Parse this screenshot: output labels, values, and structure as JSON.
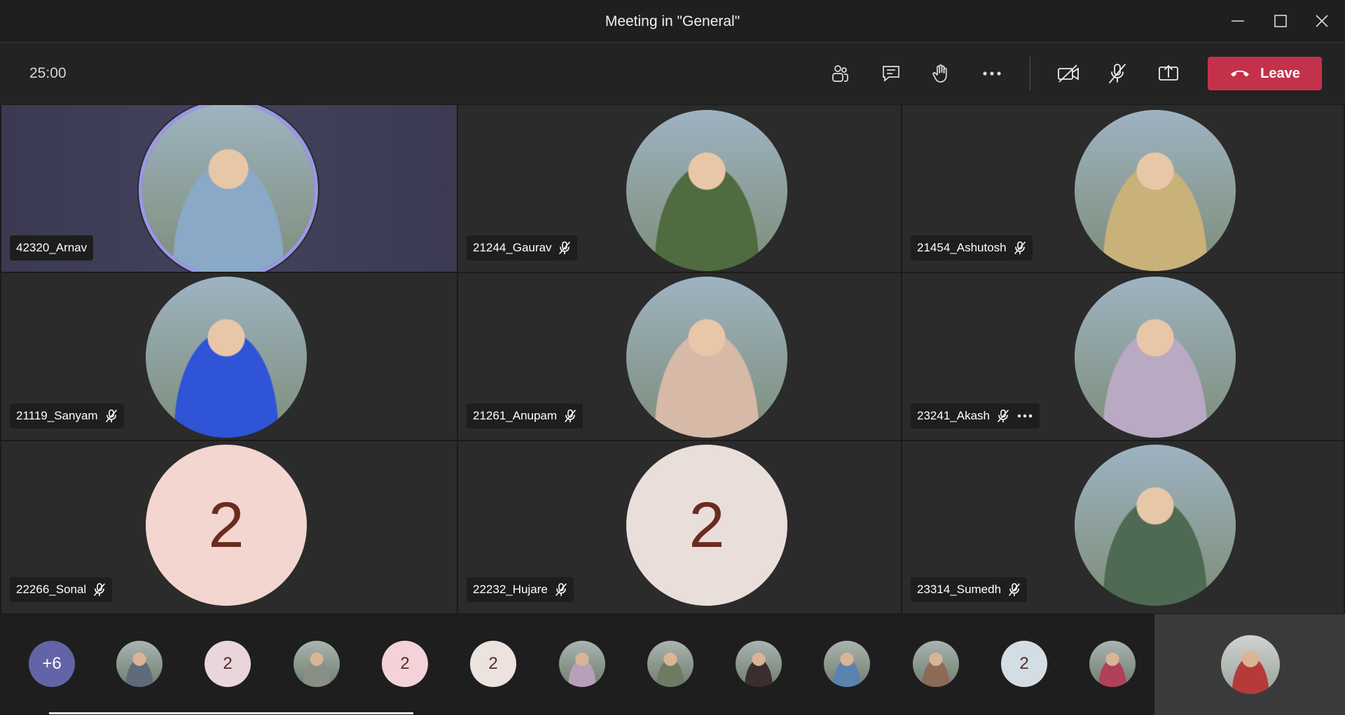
{
  "window": {
    "title": "Meeting in \"General\""
  },
  "toolbar": {
    "timer": "25:00",
    "leave_label": "Leave",
    "icons": [
      "participants-icon",
      "chat-icon",
      "raise-hand-icon",
      "more-icon",
      "camera-off-icon",
      "mic-off-icon",
      "share-screen-icon"
    ]
  },
  "participants": [
    {
      "name": "42320_Arnav",
      "muted": false,
      "speaking": true,
      "bg": "#8aa9c7"
    },
    {
      "name": "21244_Gaurav",
      "muted": true,
      "bg": "#4f6b3f"
    },
    {
      "name": "21454_Ashutosh",
      "muted": true,
      "bg": "#c9b27a"
    },
    {
      "name": "21119_Sanyam",
      "muted": true,
      "bg": "#2f54d8"
    },
    {
      "name": "21261_Anupam",
      "muted": true,
      "bg": "#d7b9a8"
    },
    {
      "name": "23241_Akash",
      "muted": true,
      "more": true,
      "bg": "#b9a9c3"
    },
    {
      "name": "22266_Sonal",
      "muted": true,
      "initial": "2",
      "bg": "#f3d6cf"
    },
    {
      "name": "22232_Hujare",
      "muted": true,
      "initial": "2",
      "bg": "#eadeda"
    },
    {
      "name": "23314_Sumedh",
      "muted": true,
      "bg": "#4f6a52"
    }
  ],
  "strip": {
    "overflow": "+6",
    "items": [
      {
        "type": "photo",
        "bg": "#5d6b7a"
      },
      {
        "type": "initial",
        "text": "2",
        "bg": "#e8d6dc"
      },
      {
        "type": "photo",
        "bg": "#8a8f86"
      },
      {
        "type": "initial",
        "text": "2",
        "bg": "#f3d2d8"
      },
      {
        "type": "initial",
        "text": "2",
        "bg": "#ece2de"
      },
      {
        "type": "photo",
        "bg": "#b6a2b8"
      },
      {
        "type": "photo",
        "bg": "#6f7a62"
      },
      {
        "type": "photo",
        "bg": "#3a2e2e"
      },
      {
        "type": "photo",
        "bg": "#5b83b0"
      },
      {
        "type": "photo",
        "bg": "#8b6b58"
      },
      {
        "type": "initial",
        "text": "2",
        "bg": "#d2dde6"
      },
      {
        "type": "photo",
        "bg": "#b0415a"
      }
    ],
    "self_bg": "#b63a3a"
  }
}
